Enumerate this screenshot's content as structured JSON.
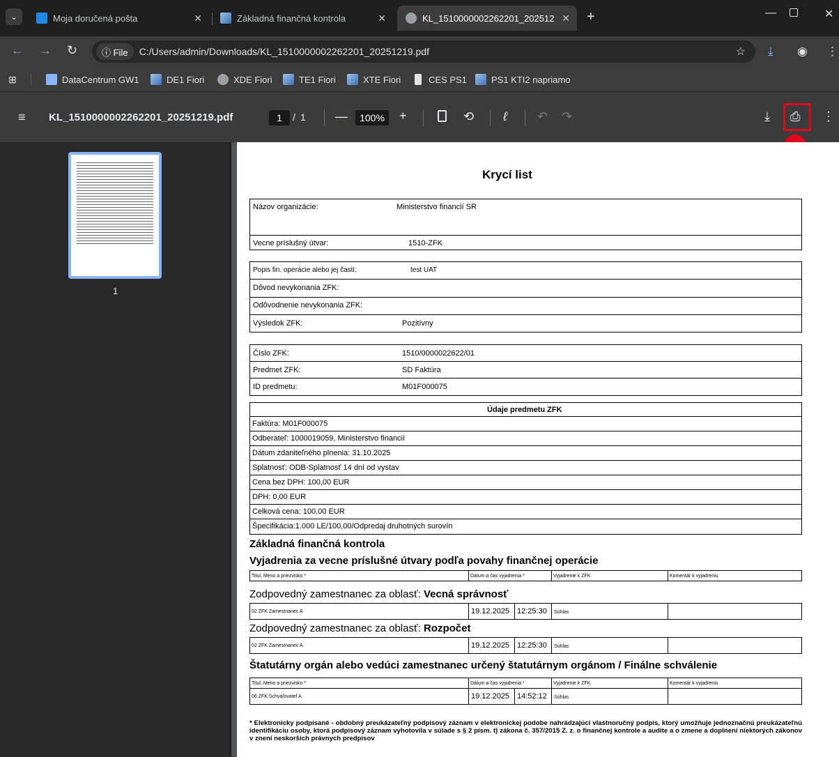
{
  "tabs": [
    {
      "title": "Moja doručená pošta",
      "color": "#1e88e5"
    },
    {
      "title": "Základná finančná kontrola",
      "color": "#5b9bd5"
    },
    {
      "title": "KL_1510000002262201_202512",
      "color": "#e8eaed"
    }
  ],
  "new_tab": "+",
  "address": {
    "chip": "ⓘ File",
    "url": "C:/Users/admin/Downloads/KL_1510000002262201_20251219.pdf"
  },
  "bookmarks": [
    "DataCentrum GW1",
    "DE1 Fiori",
    "XDE Fiori",
    "TE1 Fiori",
    "XTE Fiori",
    "CES PS1",
    "PS1 KTI2 napriamo"
  ],
  "pdf": {
    "filename": "KL_1510000002262201_20251219.pdf",
    "page": "1",
    "of": "/",
    "pages": "1",
    "zoom": "100%",
    "thumb_label": "1",
    "marker": "1"
  },
  "doc": {
    "title": "Krycí list",
    "org_label": "Názov organizácie:",
    "org_value": "Ministerstvo financií SR",
    "unit_label": "Vecne príslušný útvar:",
    "unit_value": "1510-ZFK",
    "op_label": "Popis fin. operácie alebo jej časti:",
    "op_value": "test UAT",
    "reason_label": "Dôvod nevykonania ZFK:",
    "justif_label": "Odôvodnenie nevykonania ZFK:",
    "result_label": "Výsledok ZFK:",
    "result_value": "Pozitívny",
    "num_label": "Číslo ZFK:",
    "num_value": "1510/0000022622/01",
    "subj_label": "Predmet ZFK:",
    "subj_value": "SD Faktúra",
    "id_label": "ID predmetu:",
    "id_value": "M01F000075",
    "details_title": "Údaje predmetu ZFK",
    "details": [
      "Faktúra: M01F000075",
      "Odberateľ: 1000019059, Ministerstvo financií",
      "Dátum zdaniteľného plnenia: 31.10.2025",
      "Splatnosť: ODB-Splatnosť 14 dní od vystav",
      "Cena bez DPH: 100,00 EUR",
      "DPH: 0,00 EUR",
      "Celková cena: 100,00 EUR",
      "Špecifikácia:1.000 LE/100,00/Odpredaj druhotných surovín"
    ],
    "section1": "Základná finančná kontrola",
    "section2": "Vyjadrenia za vecne príslušné útvary podľa povahy finančnej operácie",
    "col_name": "Titul, Meno a priezvisko *",
    "col_date": "Dátum a čas vyjadrenia *",
    "col_stmt": "Vyjadrenie k ZFK",
    "col_comment": "Komentár k vyjadreniu",
    "resp_prefix": "Zodpovedný zamestnanec za oblasť:",
    "area1": "Vecná správnosť",
    "area2": "Rozpočet",
    "row1": {
      "name": "02 ZFK Zamestnanec A",
      "date": "19.12.2025",
      "time": "12:25:30",
      "stmt": "Súhlas"
    },
    "row2": {
      "name": "02 ZFK Zamestnanec A",
      "date": "19.12.2025",
      "time": "12:25:30",
      "stmt": "Súhlas"
    },
    "statutory": "Štatutárny orgán alebo vedúci zamestnanec určený štatutárnym orgánom / Finálne schválenie",
    "row3": {
      "name": "06 ZFK Schvaľovateľ A",
      "date": "19.12.2025",
      "time": "14:52:12",
      "stmt": "Súhlas"
    },
    "footnote": "* Elektronicky podpísané - obdobný preukázateľný podpisový záznam v elektronickej podobe nahrádzajúci vlastnoručný podpis, ktorý umožňuje jednoznačnú preukázateľnú identifikáciu osoby, ktorá podpisový záznam vyhotovila v súlade s § 2 písm. t) zákona č. 357/2015 Z. z. o finančnej kontrole a audite a o zmene a doplnení niektorých zákonov v znení neskorších právnych predpisov"
  }
}
